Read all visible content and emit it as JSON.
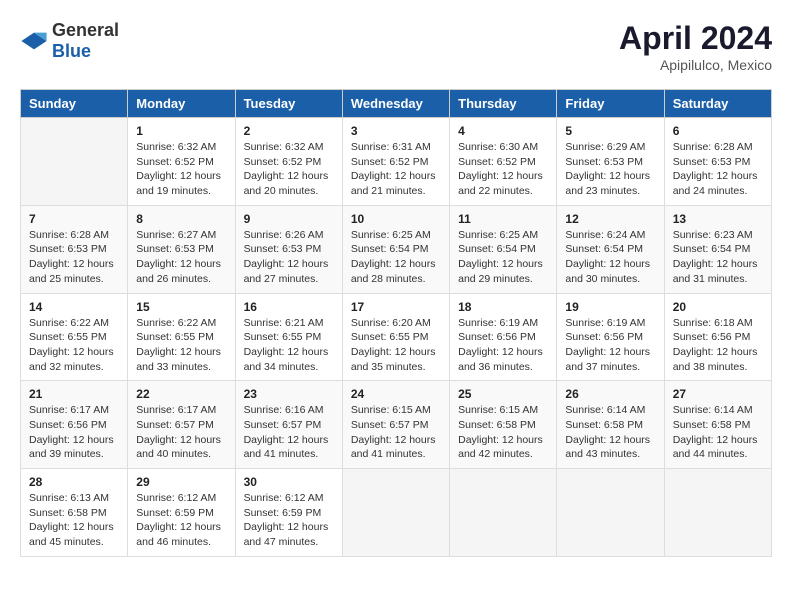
{
  "header": {
    "logo": {
      "general": "General",
      "blue": "Blue"
    },
    "title": "April 2024",
    "subtitle": "Apipilulco, Mexico"
  },
  "calendar": {
    "columns": [
      "Sunday",
      "Monday",
      "Tuesday",
      "Wednesday",
      "Thursday",
      "Friday",
      "Saturday"
    ],
    "weeks": [
      [
        {
          "day": "",
          "info": ""
        },
        {
          "day": "1",
          "info": "Sunrise: 6:32 AM\nSunset: 6:52 PM\nDaylight: 12 hours\nand 19 minutes."
        },
        {
          "day": "2",
          "info": "Sunrise: 6:32 AM\nSunset: 6:52 PM\nDaylight: 12 hours\nand 20 minutes."
        },
        {
          "day": "3",
          "info": "Sunrise: 6:31 AM\nSunset: 6:52 PM\nDaylight: 12 hours\nand 21 minutes."
        },
        {
          "day": "4",
          "info": "Sunrise: 6:30 AM\nSunset: 6:52 PM\nDaylight: 12 hours\nand 22 minutes."
        },
        {
          "day": "5",
          "info": "Sunrise: 6:29 AM\nSunset: 6:53 PM\nDaylight: 12 hours\nand 23 minutes."
        },
        {
          "day": "6",
          "info": "Sunrise: 6:28 AM\nSunset: 6:53 PM\nDaylight: 12 hours\nand 24 minutes."
        }
      ],
      [
        {
          "day": "7",
          "info": "Sunrise: 6:28 AM\nSunset: 6:53 PM\nDaylight: 12 hours\nand 25 minutes."
        },
        {
          "day": "8",
          "info": "Sunrise: 6:27 AM\nSunset: 6:53 PM\nDaylight: 12 hours\nand 26 minutes."
        },
        {
          "day": "9",
          "info": "Sunrise: 6:26 AM\nSunset: 6:53 PM\nDaylight: 12 hours\nand 27 minutes."
        },
        {
          "day": "10",
          "info": "Sunrise: 6:25 AM\nSunset: 6:54 PM\nDaylight: 12 hours\nand 28 minutes."
        },
        {
          "day": "11",
          "info": "Sunrise: 6:25 AM\nSunset: 6:54 PM\nDaylight: 12 hours\nand 29 minutes."
        },
        {
          "day": "12",
          "info": "Sunrise: 6:24 AM\nSunset: 6:54 PM\nDaylight: 12 hours\nand 30 minutes."
        },
        {
          "day": "13",
          "info": "Sunrise: 6:23 AM\nSunset: 6:54 PM\nDaylight: 12 hours\nand 31 minutes."
        }
      ],
      [
        {
          "day": "14",
          "info": "Sunrise: 6:22 AM\nSunset: 6:55 PM\nDaylight: 12 hours\nand 32 minutes."
        },
        {
          "day": "15",
          "info": "Sunrise: 6:22 AM\nSunset: 6:55 PM\nDaylight: 12 hours\nand 33 minutes."
        },
        {
          "day": "16",
          "info": "Sunrise: 6:21 AM\nSunset: 6:55 PM\nDaylight: 12 hours\nand 34 minutes."
        },
        {
          "day": "17",
          "info": "Sunrise: 6:20 AM\nSunset: 6:55 PM\nDaylight: 12 hours\nand 35 minutes."
        },
        {
          "day": "18",
          "info": "Sunrise: 6:19 AM\nSunset: 6:56 PM\nDaylight: 12 hours\nand 36 minutes."
        },
        {
          "day": "19",
          "info": "Sunrise: 6:19 AM\nSunset: 6:56 PM\nDaylight: 12 hours\nand 37 minutes."
        },
        {
          "day": "20",
          "info": "Sunrise: 6:18 AM\nSunset: 6:56 PM\nDaylight: 12 hours\nand 38 minutes."
        }
      ],
      [
        {
          "day": "21",
          "info": "Sunrise: 6:17 AM\nSunset: 6:56 PM\nDaylight: 12 hours\nand 39 minutes."
        },
        {
          "day": "22",
          "info": "Sunrise: 6:17 AM\nSunset: 6:57 PM\nDaylight: 12 hours\nand 40 minutes."
        },
        {
          "day": "23",
          "info": "Sunrise: 6:16 AM\nSunset: 6:57 PM\nDaylight: 12 hours\nand 41 minutes."
        },
        {
          "day": "24",
          "info": "Sunrise: 6:15 AM\nSunset: 6:57 PM\nDaylight: 12 hours\nand 41 minutes."
        },
        {
          "day": "25",
          "info": "Sunrise: 6:15 AM\nSunset: 6:58 PM\nDaylight: 12 hours\nand 42 minutes."
        },
        {
          "day": "26",
          "info": "Sunrise: 6:14 AM\nSunset: 6:58 PM\nDaylight: 12 hours\nand 43 minutes."
        },
        {
          "day": "27",
          "info": "Sunrise: 6:14 AM\nSunset: 6:58 PM\nDaylight: 12 hours\nand 44 minutes."
        }
      ],
      [
        {
          "day": "28",
          "info": "Sunrise: 6:13 AM\nSunset: 6:58 PM\nDaylight: 12 hours\nand 45 minutes."
        },
        {
          "day": "29",
          "info": "Sunrise: 6:12 AM\nSunset: 6:59 PM\nDaylight: 12 hours\nand 46 minutes."
        },
        {
          "day": "30",
          "info": "Sunrise: 6:12 AM\nSunset: 6:59 PM\nDaylight: 12 hours\nand 47 minutes."
        },
        {
          "day": "",
          "info": ""
        },
        {
          "day": "",
          "info": ""
        },
        {
          "day": "",
          "info": ""
        },
        {
          "day": "",
          "info": ""
        }
      ]
    ]
  }
}
